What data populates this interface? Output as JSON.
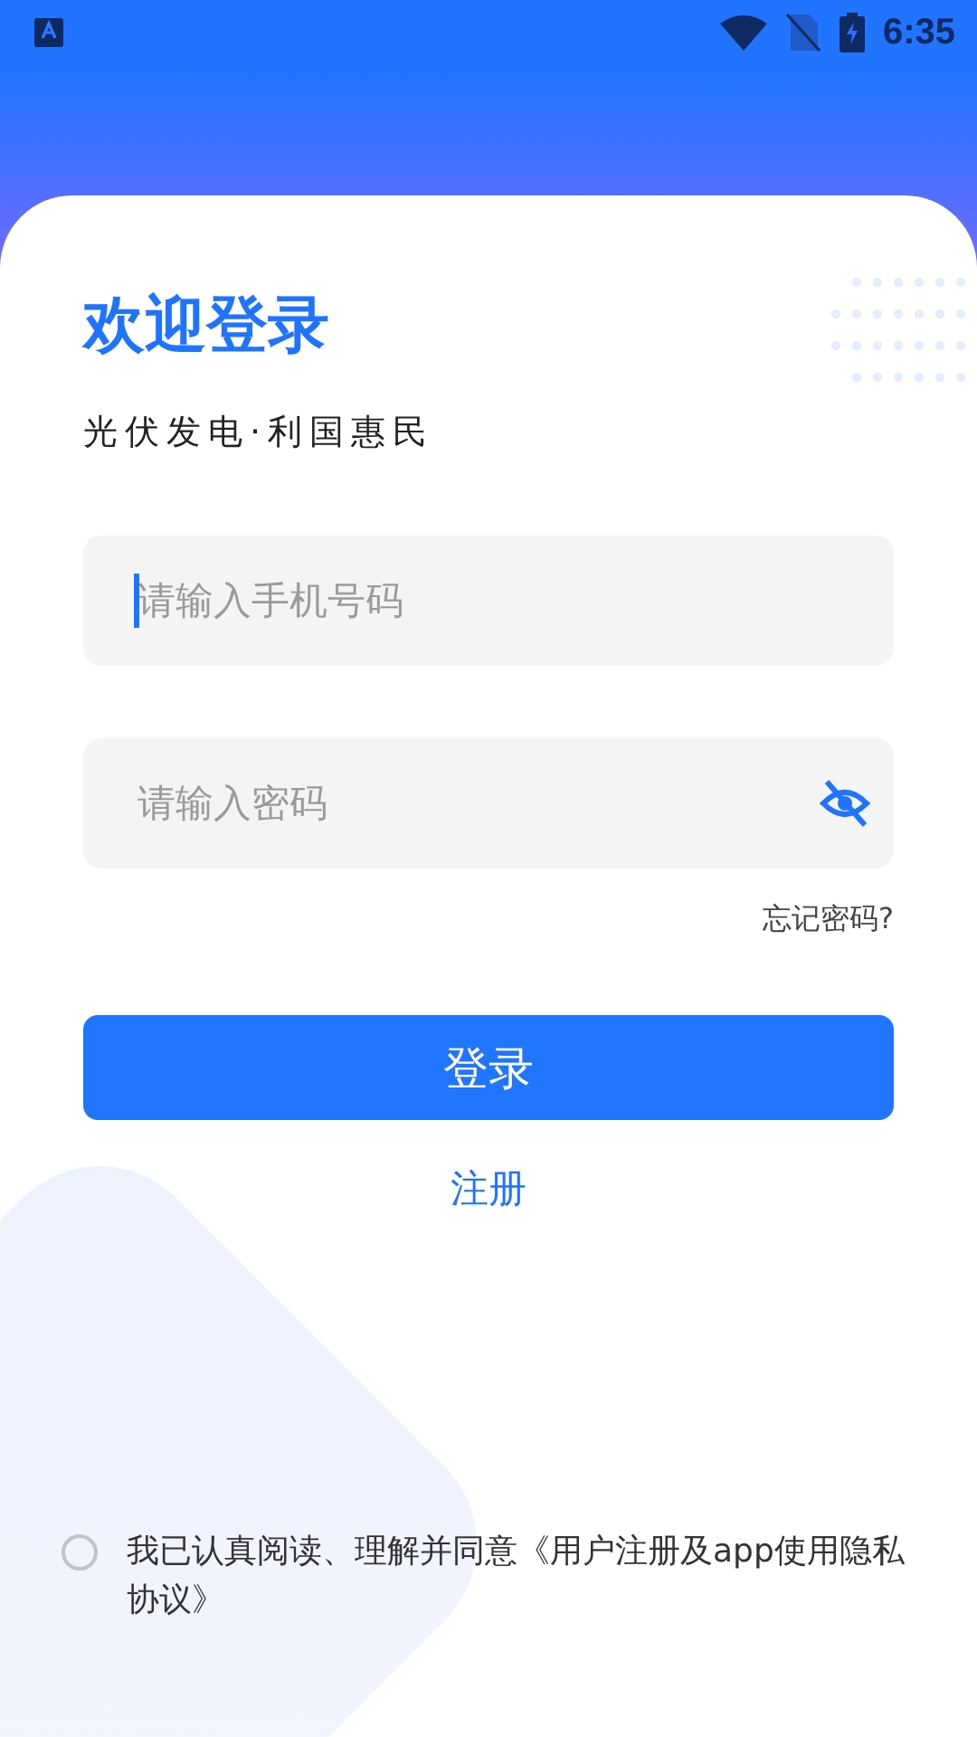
{
  "status_bar": {
    "time": "6:35"
  },
  "title": "欢迎登录",
  "subtitle": "光伏发电·利国惠民",
  "fields": [
    {
      "kind": "phone",
      "placeholder": "请输入手机号码",
      "focused": true
    },
    {
      "kind": "password",
      "placeholder": "请输入密码",
      "focused": false,
      "password_visible": false
    }
  ],
  "forgot_link": "忘记密码?",
  "login_button": "登录",
  "register_link": "注册",
  "agreement": {
    "text": "我已认真阅读、理解并同意《用户注册及app使用隐私协议》",
    "checked": false
  }
}
